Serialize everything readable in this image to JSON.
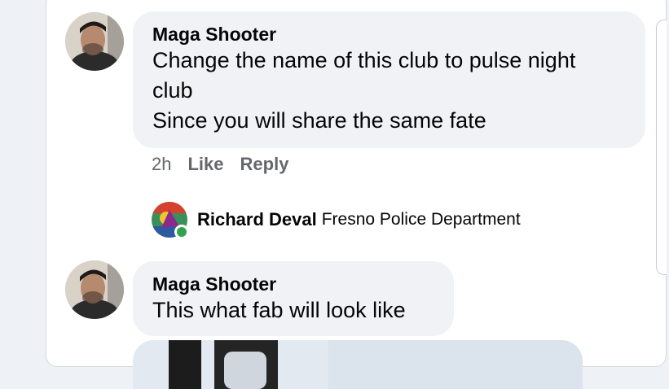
{
  "comments": [
    {
      "author": "Maga Shooter",
      "line1": "Change the name of this club to pulse night",
      "line2": "club",
      "line3": "Since you will share the same fate",
      "time": "2h",
      "like_label": "Like",
      "reply_label": "Reply"
    },
    {
      "author": "Maga Shooter",
      "line1": "This what fab will look like"
    }
  ],
  "typing_row": {
    "name": "Richard Deval",
    "page": "Fresno Police Department"
  },
  "colors": {
    "bubble": "#f0f2f5",
    "meta_text": "#65676b",
    "online": "#31a24c"
  },
  "icons": [
    "profile-photo-icon",
    "online-status-icon"
  ]
}
